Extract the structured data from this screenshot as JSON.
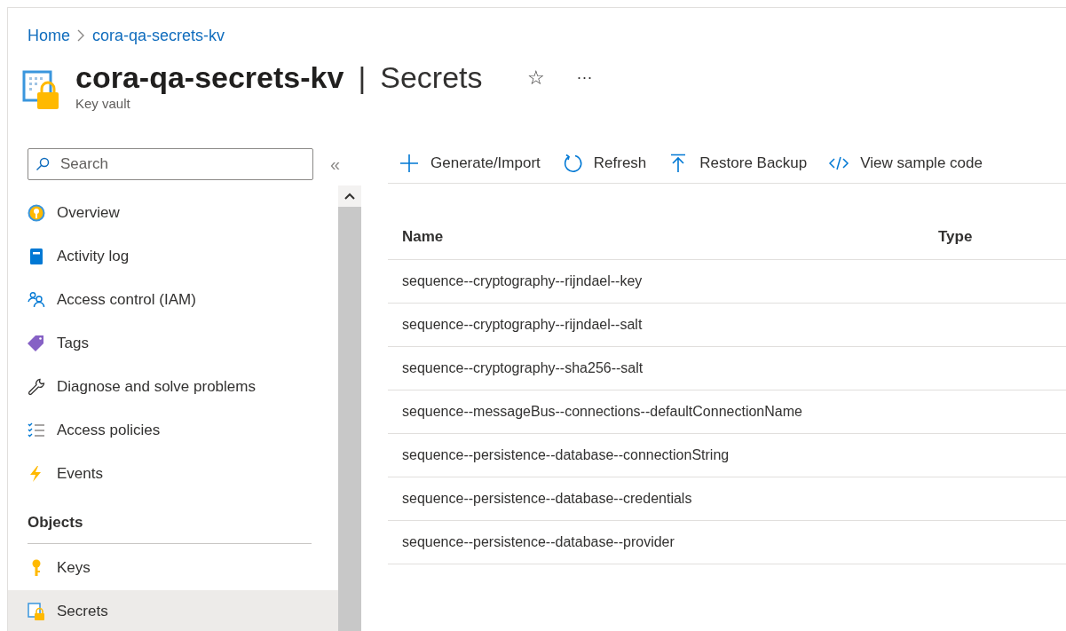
{
  "breadcrumb": [
    {
      "label": "Home"
    },
    {
      "label": "cora-qa-secrets-kv"
    }
  ],
  "header": {
    "resource": "cora-qa-secrets-kv",
    "separator": "|",
    "page": "Secrets",
    "subtitle": "Key vault",
    "favorite": "☆",
    "more": "···"
  },
  "sidebar": {
    "search": {
      "placeholder": "Search"
    },
    "collapse": "«",
    "items": [
      {
        "label": "Overview",
        "selected": false
      },
      {
        "label": "Activity log",
        "selected": false
      },
      {
        "label": "Access control (IAM)",
        "selected": false
      },
      {
        "label": "Tags",
        "selected": false
      },
      {
        "label": "Diagnose and solve problems",
        "selected": false
      },
      {
        "label": "Access policies",
        "selected": false
      },
      {
        "label": "Events",
        "selected": false
      }
    ],
    "section": {
      "title": "Objects",
      "items": [
        {
          "label": "Keys",
          "selected": false
        },
        {
          "label": "Secrets",
          "selected": true
        }
      ]
    }
  },
  "toolbar": [
    {
      "label": "Generate/Import"
    },
    {
      "label": "Refresh"
    },
    {
      "label": "Restore Backup"
    },
    {
      "label": "View sample code"
    }
  ],
  "table": {
    "columns": [
      "Name",
      "Type"
    ],
    "rows": [
      {
        "name": "sequence--cryptography--rijndael--key"
      },
      {
        "name": "sequence--cryptography--rijndael--salt"
      },
      {
        "name": "sequence--cryptography--sha256--salt"
      },
      {
        "name": "sequence--messageBus--connections--defaultConnectionName"
      },
      {
        "name": "sequence--persistence--database--connectionString"
      },
      {
        "name": "sequence--persistence--database--credentials"
      },
      {
        "name": "sequence--persistence--database--provider"
      }
    ]
  }
}
